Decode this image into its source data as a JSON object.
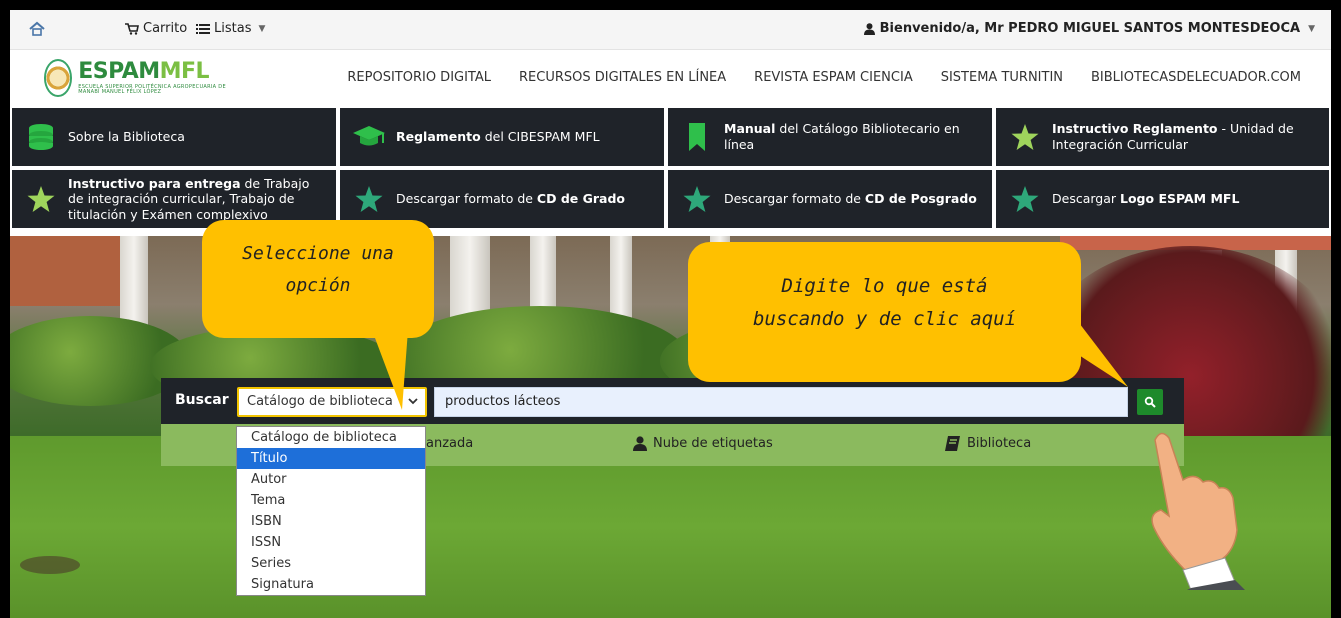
{
  "topbar": {
    "home_icon": "home-icon",
    "cart_label": "Carrito",
    "lists_label": "Listas",
    "welcome_text": "Bienvenido/a, Mr PEDRO MIGUEL SANTOS MONTESDEOCA"
  },
  "header": {
    "logo_name_a": "ESPAM",
    "logo_name_b": "MFL",
    "logo_sub": "ESCUELA SUPERIOR POLITÉCNICA AGROPECUARIA DE MANABÍ MANUEL FÉLIX LÓPEZ",
    "nav": [
      "REPOSITORIO DIGITAL",
      "RECURSOS DIGITALES EN LÍNEA",
      "REVISTA ESPAM CIENCIA",
      "SISTEMA TURNITIN",
      "BIBLIOTECASDELECUADOR.COM"
    ]
  },
  "quick_links": [
    {
      "bold": "",
      "text": "Sobre la Biblioteca",
      "icon": "database-icon"
    },
    {
      "bold": "Reglamento",
      "text": " del CIBESPAM MFL",
      "icon": "graduation-cap-icon"
    },
    {
      "bold": "Manual",
      "text": " del Catálogo Bibliotecario en línea",
      "icon": "bookmark-icon"
    },
    {
      "bold": "Instructivo Reglamento",
      "text": " - Unidad de Integración Curricular",
      "icon": "star-icon"
    },
    {
      "bold": "Instructivo para entrega",
      "text": " de Trabajo de integración curricular, Trabajo de titulación y Exámen complexivo",
      "icon": "star-icon"
    },
    {
      "bold": "",
      "text": "Descargar formato de ",
      "bold2": "CD de Grado",
      "icon": "star-icon"
    },
    {
      "bold": "",
      "text": "Descargar formato de ",
      "bold2": "CD de Posgrado",
      "icon": "star-icon"
    },
    {
      "bold": "",
      "text": "Descargar ",
      "bold2": "Logo ESPAM MFL",
      "icon": "star-icon"
    }
  ],
  "colors": {
    "green": "#1e8a2b",
    "dark": "#1f2329",
    "callout": "#ffc000",
    "subnav": "#8bba5e",
    "select_highlight": "#1e6fd9"
  },
  "search": {
    "label": "Buscar",
    "selected_option": "Catálogo de biblioteca",
    "query": "productos lácteos",
    "button_icon": "search-icon"
  },
  "dropdown_options": [
    "Catálogo de biblioteca",
    "Título",
    "Autor",
    "Tema",
    "ISBN",
    "ISSN",
    "Series",
    "Signatura"
  ],
  "dropdown_highlighted": "Título",
  "subnav": {
    "advanced_partial": "anzada",
    "tag_cloud": "Nube de etiquetas",
    "library": "Biblioteca"
  },
  "callouts": {
    "select_line1": "Seleccione una",
    "select_line2": "opción",
    "search_line1": "Digite lo que está",
    "search_line2": "buscando y de clic aquí"
  }
}
